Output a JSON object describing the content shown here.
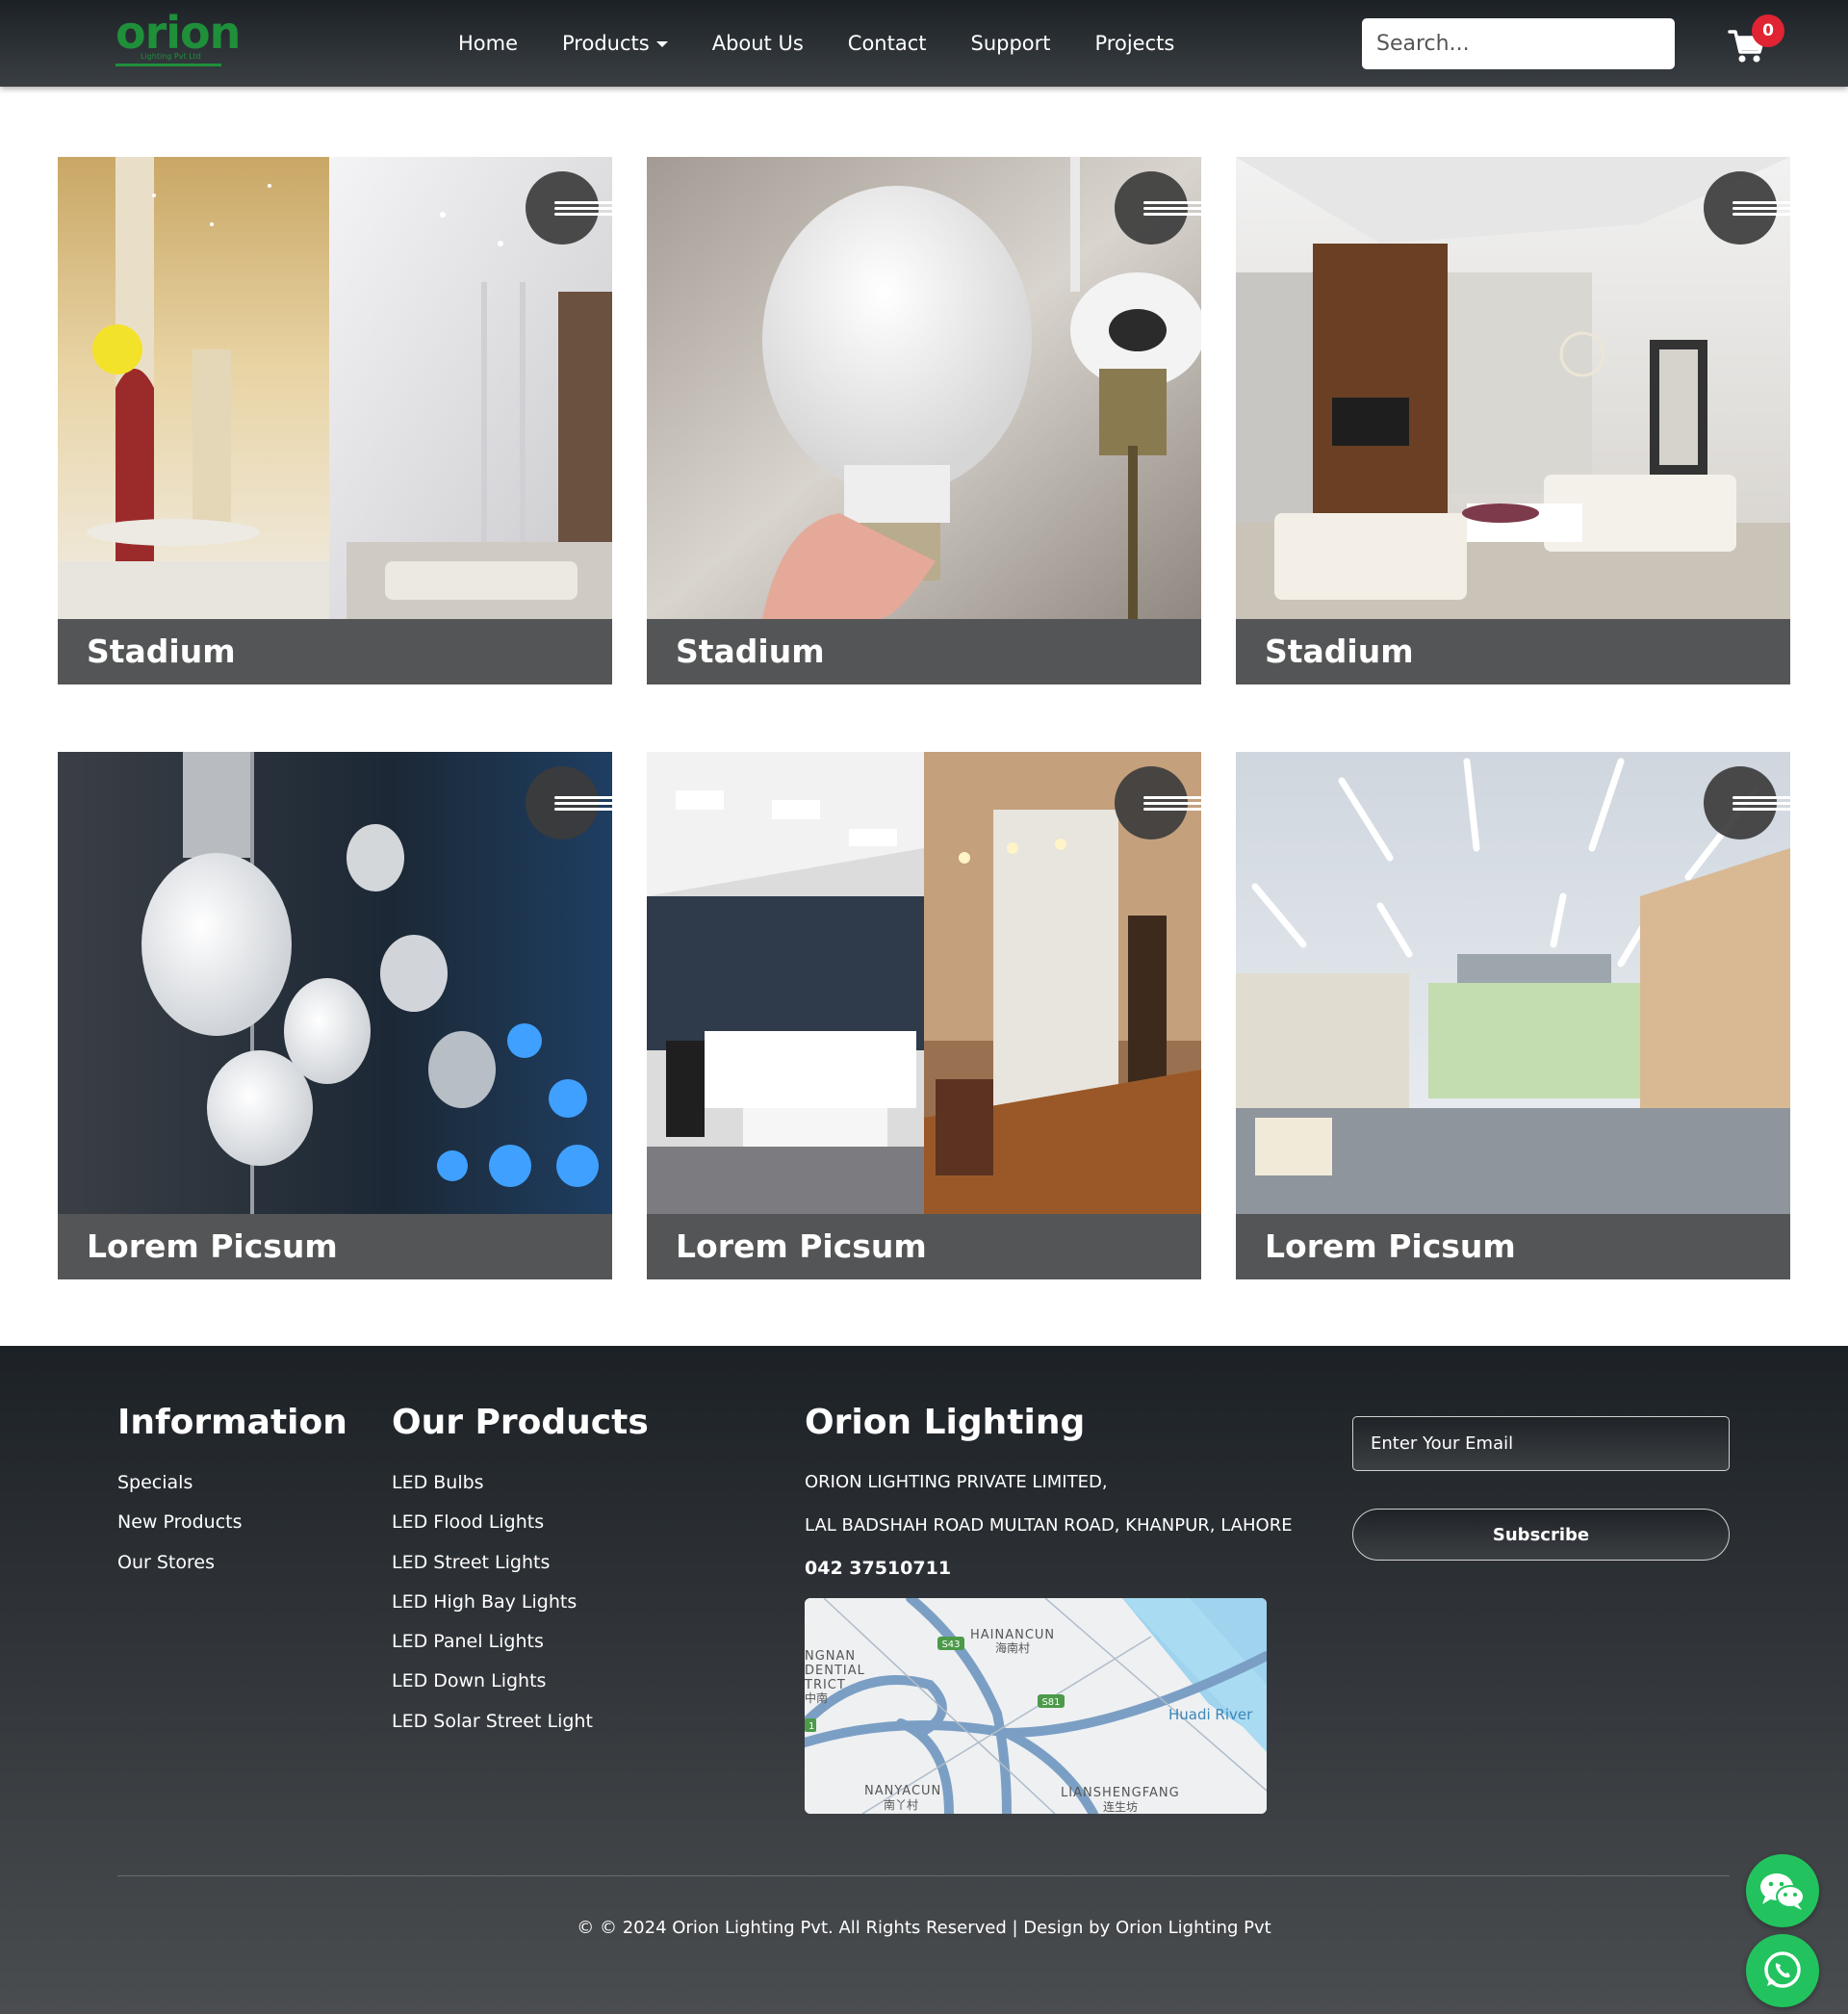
{
  "brand": {
    "logo_word": "orion",
    "logo_sub": "Lighting Pvt Ltd",
    "logo_color": "#1f8f3a"
  },
  "nav": {
    "items": [
      {
        "label": "Home",
        "has_caret": false
      },
      {
        "label": "Products",
        "has_caret": true
      },
      {
        "label": "About Us",
        "has_caret": false
      },
      {
        "label": "Contact",
        "has_caret": false
      },
      {
        "label": "Support",
        "has_caret": false
      },
      {
        "label": "Projects",
        "has_caret": false
      }
    ],
    "search_placeholder": "Search...",
    "cart_icon": "shopping-cart-icon",
    "cart_count": "0",
    "badge_color": "#e02433"
  },
  "gallery": {
    "menu_icon": "hamburger-menu-icon",
    "cards": [
      {
        "caption": "Stadium"
      },
      {
        "caption": "Stadium"
      },
      {
        "caption": "Stadium"
      },
      {
        "caption": "Lorem Picsum"
      },
      {
        "caption": "Lorem Picsum"
      },
      {
        "caption": "Lorem Picsum"
      }
    ]
  },
  "footer": {
    "information": {
      "heading": "Information",
      "links": [
        "Specials",
        "New Products",
        "Our Stores"
      ]
    },
    "products": {
      "heading": "Our Products",
      "links": [
        "LED Bulbs",
        "LED Flood Lights",
        "LED Street Lights",
        "LED High Bay Lights",
        "LED Panel Lights",
        "LED Down Lights",
        "LED Solar Street Light"
      ]
    },
    "company": {
      "heading": "Orion Lighting",
      "name": "ORION LIGHTING PRIVATE LIMITED,",
      "address": "LAL BADSHAH ROAD MULTAN ROAD, KHANPUR, LAHORE",
      "phone": "042 37510711"
    },
    "map": {
      "labels": {
        "hainancun": "HAINANCUN",
        "hainancun_cn": "海南村",
        "nannan": "NGNAN",
        "dential": "DENTIAL",
        "trict": "TRICT",
        "cn_left": "中南",
        "huadi": "Huadi River",
        "nanyacun": "NANYACUN",
        "nanyacun_cn": "南丫村",
        "lian": "LIANSHENGFANG",
        "lian_cn": "连生坊",
        "s43": "S43",
        "s81": "S81",
        "s1": "1"
      }
    },
    "newsletter": {
      "email_placeholder": "Enter Your Email",
      "subscribe_label": "Subscribe"
    },
    "copyright": "© © 2024 Orion Lighting Pvt. All Rights Reserved | Design by Orion Lighting Pvt"
  },
  "floating": {
    "wechat_icon": "wechat-icon",
    "whatsapp_icon": "whatsapp-icon",
    "fab_color": "#22c35e"
  }
}
